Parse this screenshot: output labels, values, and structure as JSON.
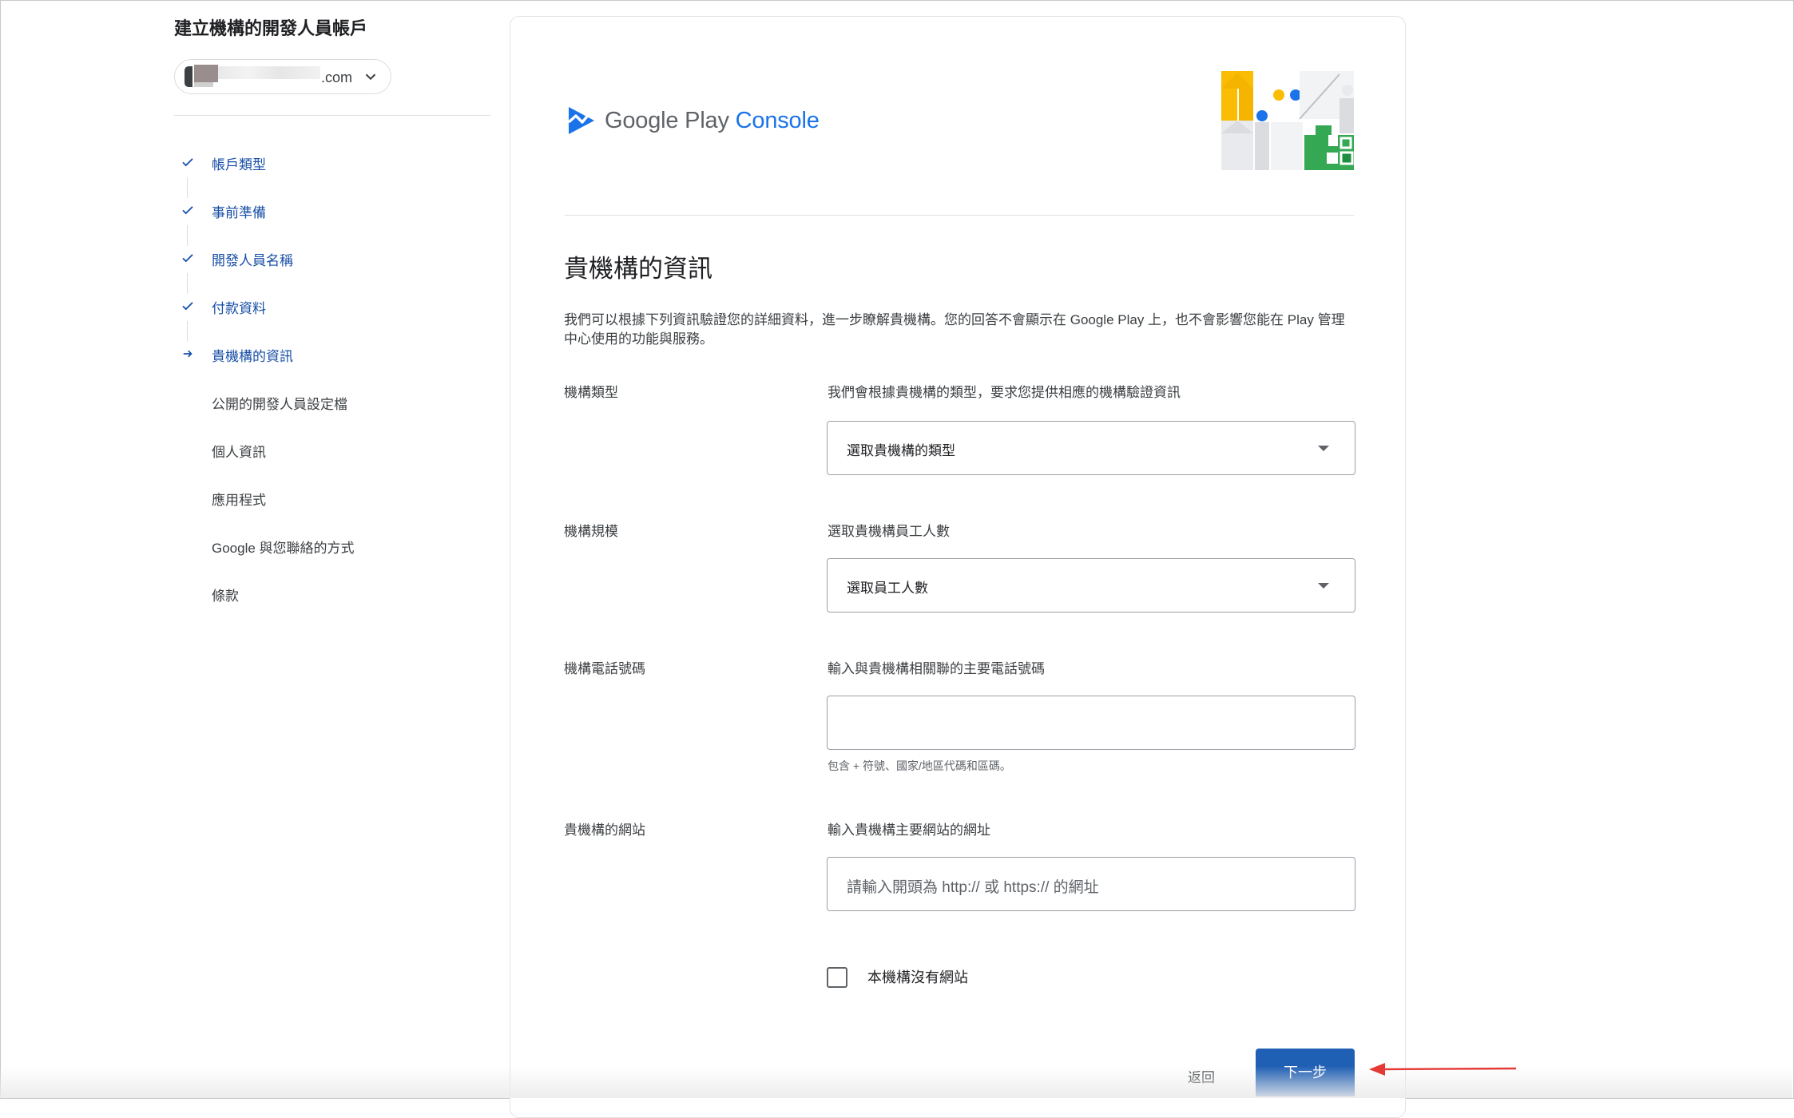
{
  "sidebar": {
    "title": "建立機構的開發人員帳戶",
    "account": {
      "domain": ".com"
    },
    "steps": [
      {
        "label": "帳戶類型",
        "state": "done"
      },
      {
        "label": "事前準備",
        "state": "done"
      },
      {
        "label": "開發人員名稱",
        "state": "done"
      },
      {
        "label": "付款資料",
        "state": "done"
      },
      {
        "label": "貴機構的資訊",
        "state": "current"
      },
      {
        "label": "公開的開發人員設定檔",
        "state": "todo"
      },
      {
        "label": "個人資訊",
        "state": "todo"
      },
      {
        "label": "應用程式",
        "state": "todo"
      },
      {
        "label": "Google 與您聯絡的方式",
        "state": "todo"
      },
      {
        "label": "條款",
        "state": "todo"
      }
    ]
  },
  "brand": {
    "name_prefix": "Google Play",
    "name_suffix": "Console",
    "accent": "#1a73e8"
  },
  "section": {
    "title": "貴機構的資訊",
    "intro": "我們可以根據下列資訊驗證您的詳細資料，進一步瞭解貴機構。您的回答不會顯示在 Google Play 上，也不會影響您能在 Play 管理中心使用的功能與服務。"
  },
  "fields": {
    "org_type": {
      "label": "機構類型",
      "desc": "我們會根據貴機構的類型，要求您提供相應的機構驗證資訊",
      "value": "選取貴機構的類型"
    },
    "org_size": {
      "label": "機構規模",
      "desc": "選取貴機構員工人數",
      "value": "選取員工人數"
    },
    "phone": {
      "label": "機構電話號碼",
      "desc": "輸入與貴機構相關聯的主要電話號碼",
      "value": "",
      "hint": "包含 + 符號、國家/地區代碼和區碼。"
    },
    "website": {
      "label": "貴機構的網站",
      "desc": "輸入貴機構主要網站的網址",
      "placeholder": "請輸入開頭為 http:// 或 https:// 的網址"
    }
  },
  "no_website": {
    "label": "本機構沒有網站",
    "checked": false
  },
  "actions": {
    "back": "返回",
    "next": "下一步"
  },
  "colors": {
    "primary_button": "#1f5fb4",
    "step_active": "#174ea6",
    "annotation_arrow": "#e53935"
  }
}
